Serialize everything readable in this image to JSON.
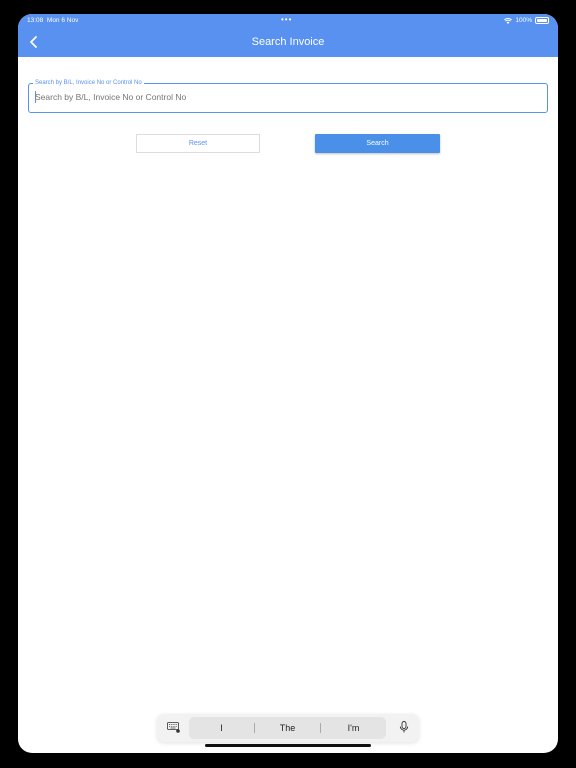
{
  "status_bar": {
    "time": "13:08",
    "date": "Mon 6 Nov",
    "dots": "•••",
    "battery": "100%"
  },
  "nav": {
    "title": "Search Invoice"
  },
  "search": {
    "label": "Search by B/L, Invoice No or Control No",
    "placeholder": "Search by B/L, Invoice No or Control No",
    "value": ""
  },
  "buttons": {
    "reset": "Reset",
    "search": "Search"
  },
  "keyboard": {
    "suggestions": [
      "I",
      "The",
      "I'm"
    ]
  },
  "colors": {
    "accent": "#5891f0",
    "button": "#4a90e8"
  }
}
